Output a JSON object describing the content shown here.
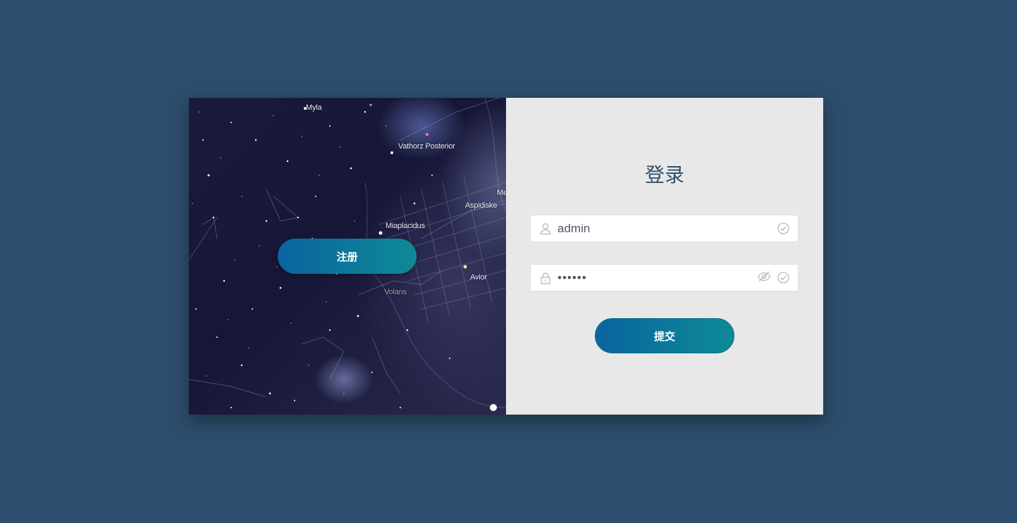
{
  "left_panel": {
    "star_labels": [
      "Myla",
      "Vathorz Posterior",
      "Aspidiske",
      "Miaplacidus",
      "Avior",
      "Volans",
      "Me"
    ],
    "register_label": "注册"
  },
  "login": {
    "title": "登录",
    "username": {
      "value": "admin",
      "prefix_icon": "user-icon",
      "suffix_icon": "circle-check-icon"
    },
    "password": {
      "value": "123456",
      "prefix_icon": "lock-icon",
      "suffix_icons": [
        "eye-off-icon",
        "circle-check-icon"
      ]
    },
    "submit_label": "提交"
  },
  "colors": {
    "page_background": "#2d4d6c",
    "panel_background": "#e9e8e9",
    "button_gradient_start": "#0a64a0",
    "button_gradient_end": "#0e8a96",
    "title_color": "#2f4f6d"
  }
}
